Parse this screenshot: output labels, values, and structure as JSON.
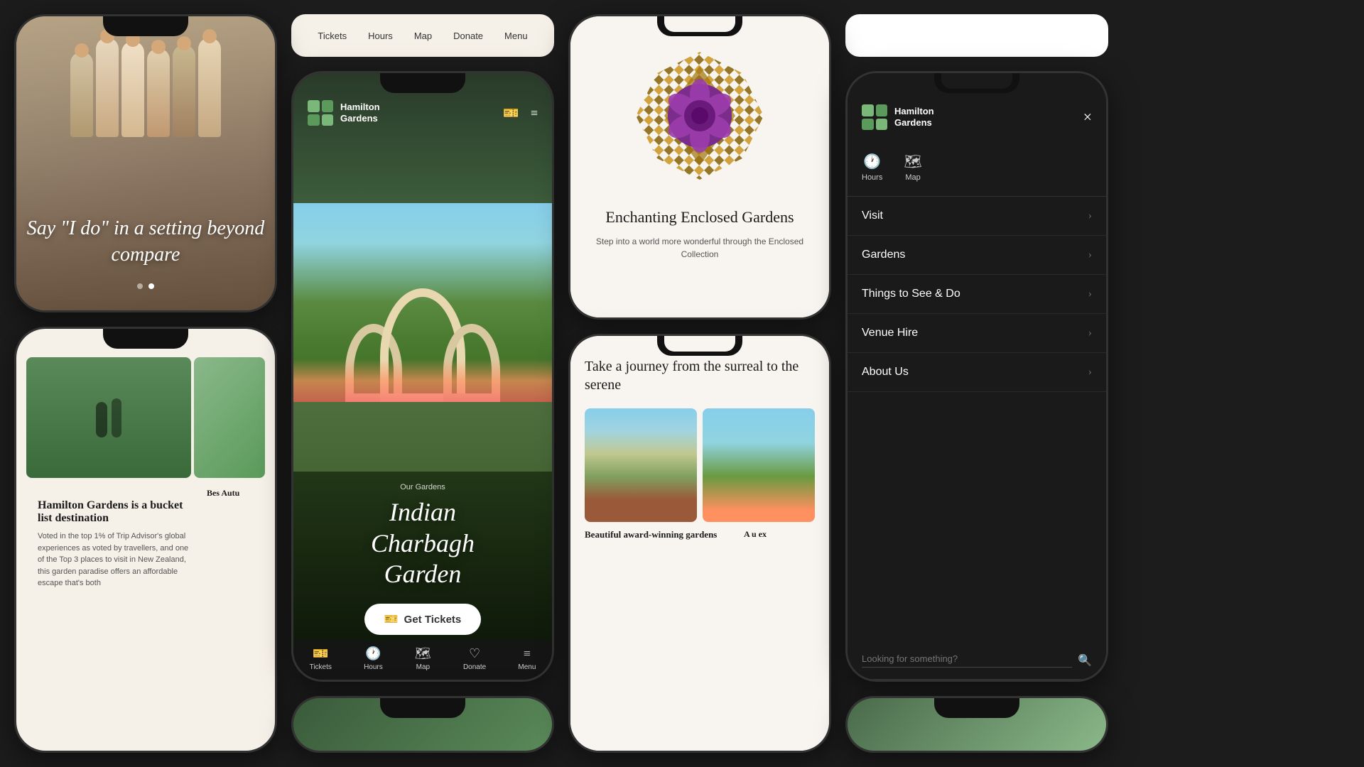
{
  "app": {
    "name": "Hamilton Gardens",
    "background_color": "#1c1c1c"
  },
  "phone1_wedding": {
    "title": "Say \"I do\" in a setting beyond compare",
    "dots": [
      false,
      true
    ]
  },
  "phone2_bucket": {
    "title": "Hamilton Gardens is a bucket list destination",
    "body": "Voted in the top 1% of Trip Advisor's global experiences as voted by travellers, and one of the Top 3 places to visit in New Zealand, this garden paradise offers an affordable escape that's both",
    "card2_title": "Bes Autu"
  },
  "topnav": {
    "items": [
      "Tickets",
      "Hours",
      "Map",
      "Donate",
      "Menu"
    ]
  },
  "phone_main": {
    "logo_name": "Hamilton\nGardens",
    "garden_label": "Our Gardens",
    "garden_title": "Indian\nCharbagh\nGarden",
    "get_tickets": "Get Tickets",
    "nav_items": [
      {
        "icon": "🎫",
        "label": "Tickets"
      },
      {
        "icon": "🕐",
        "label": "Hours"
      },
      {
        "icon": "🗺",
        "label": "Map"
      },
      {
        "icon": "♡",
        "label": "Donate"
      },
      {
        "icon": "≡",
        "label": "Menu"
      }
    ]
  },
  "phone_flower": {
    "title": "Enchanting\nEnclosed Gardens",
    "description": "Step into a world more wonderful through the Enclosed Collection"
  },
  "phone_journey": {
    "title": "Take a journey from the surreal to the serene",
    "award_title": "Beautiful award-winning gardens",
    "card2": "A u ex"
  },
  "phone_menu": {
    "logo_name": "Hamilton\nGardens",
    "close_icon": "×",
    "quick_icons": [
      {
        "icon": "🕐",
        "label": "Hours"
      },
      {
        "icon": "🗺",
        "label": "Map"
      }
    ],
    "items": [
      {
        "label": "Visit"
      },
      {
        "label": "Gardens"
      },
      {
        "label": "Things to See & Do"
      },
      {
        "label": "Venue Hire"
      },
      {
        "label": "About Us"
      }
    ],
    "search_placeholder": "Looking for something?"
  }
}
